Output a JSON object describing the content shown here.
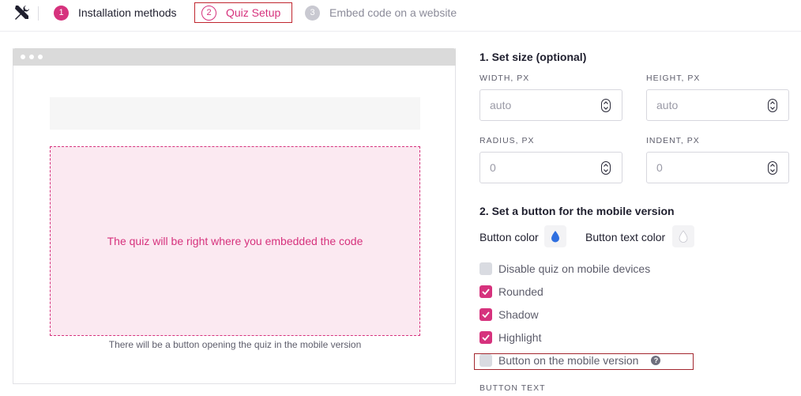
{
  "stepper": {
    "steps": [
      {
        "num": "1",
        "label": "Installation methods"
      },
      {
        "num": "2",
        "label": "Quiz Setup"
      },
      {
        "num": "3",
        "label": "Embed code on a website"
      }
    ]
  },
  "preview": {
    "quiz_text": "The quiz will be right where you embedded the code",
    "note": "There will be a button opening the quiz in the mobile version"
  },
  "settings": {
    "size_title": "1. Set size (optional)",
    "width": {
      "label": "WIDTH, PX",
      "placeholder": "auto"
    },
    "height": {
      "label": "HEIGHT, PX",
      "placeholder": "auto"
    },
    "radius": {
      "label": "RADIUS, PX",
      "placeholder": "0"
    },
    "indent": {
      "label": "INDENT, PX",
      "placeholder": "0"
    },
    "button_title": "2. Set a button for the mobile version",
    "button_color_label": "Button color",
    "button_text_color_label": "Button text color",
    "button_color": "#2f6fe0",
    "button_text_color": "#ffffff",
    "options": [
      {
        "label": "Disable quiz on mobile devices",
        "checked": false
      },
      {
        "label": "Rounded",
        "checked": true
      },
      {
        "label": "Shadow",
        "checked": true
      },
      {
        "label": "Highlight",
        "checked": true
      },
      {
        "label": "Button on the mobile version",
        "checked": false
      }
    ],
    "button_text_label": "BUTTON TEXT"
  },
  "colors": {
    "accent": "#d6327d",
    "highlight_border": "#c0262f"
  }
}
